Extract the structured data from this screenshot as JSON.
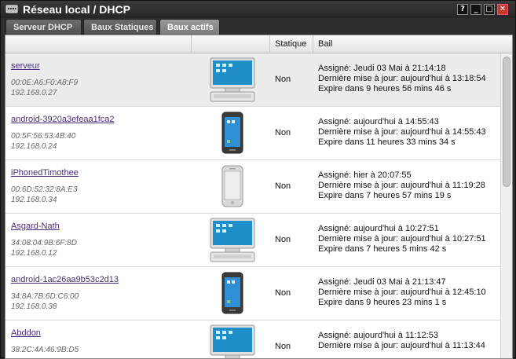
{
  "window": {
    "title": "Réseau local / DHCP",
    "buttons": {
      "help": "?",
      "minimize": "_",
      "maximize": "□",
      "close": "✕"
    }
  },
  "tabs": [
    {
      "label": "Serveur DHCP",
      "active": false
    },
    {
      "label": "Baux Statiques",
      "active": false
    },
    {
      "label": "Baux actifs",
      "active": true
    }
  ],
  "table": {
    "headers": {
      "device": "",
      "icon": "",
      "static": "Statique",
      "lease": "Bail"
    },
    "rows": [
      {
        "name": "serveur",
        "mac": "00:0E:A6:F0:A8:F9",
        "ip": "192.168.0.27",
        "device_type": "desktop-computer-icon",
        "static": "Non",
        "assigned": "Assigné: Jeudi 03 Mai à 21:14:18",
        "updated": "Dernière mise à jour: aujourd'hui à 13:18:54",
        "expires": "Expire dans 9 heures 56 mins 46 s"
      },
      {
        "name": "android-3920a3efeaa1fca2",
        "mac": "00:5F:56:53:4B:40",
        "ip": "192.168.0.24",
        "device_type": "android-phone-icon",
        "static": "Non",
        "assigned": "Assigné: aujourd'hui à 14:55:43",
        "updated": "Dernière mise à jour: aujourd'hui à 14:55:43",
        "expires": "Expire dans 11 heures 33 mins 34 s"
      },
      {
        "name": "iPhonedTimothee",
        "mac": "00:6D:52:32:8A:E3",
        "ip": "192.168.0.34",
        "device_type": "iphone-icon",
        "static": "Non",
        "assigned": "Assigné: hier à 20:07:55",
        "updated": "Dernière mise à jour: aujourd'hui à 11:19:28",
        "expires": "Expire dans 7 heures 57 mins 19 s"
      },
      {
        "name": "Asgard-Nath",
        "mac": "34:08:04:9B:6F:8D",
        "ip": "192.168.0.12",
        "device_type": "desktop-computer-icon",
        "static": "Non",
        "assigned": "Assigné: aujourd'hui à 10:27:51",
        "updated": "Dernière mise à jour: aujourd'hui à 10:27:51",
        "expires": "Expire dans 7 heures 5 mins 42 s"
      },
      {
        "name": "android-1ac26aa9b53c2d13",
        "mac": "34:8A:7B:6D:C6:00",
        "ip": "192.168.0.38",
        "device_type": "android-phone-icon",
        "static": "Non",
        "assigned": "Assigné: Jeudi 03 Mai à 21:13:47",
        "updated": "Dernière mise à jour: aujourd'hui à 12:45:10",
        "expires": "Expire dans 9 heures 23 mins 1 s"
      },
      {
        "name": "Abddon",
        "mac": "38:2C:4A:46:9B:D5",
        "ip": "",
        "device_type": "desktop-computer-icon",
        "static": "Non",
        "assigned": "Assigné: aujourd'hui à 11:12:53",
        "updated": "Dernière mise à jour: aujourd'hui à 11:13:44",
        "expires": ""
      }
    ]
  }
}
